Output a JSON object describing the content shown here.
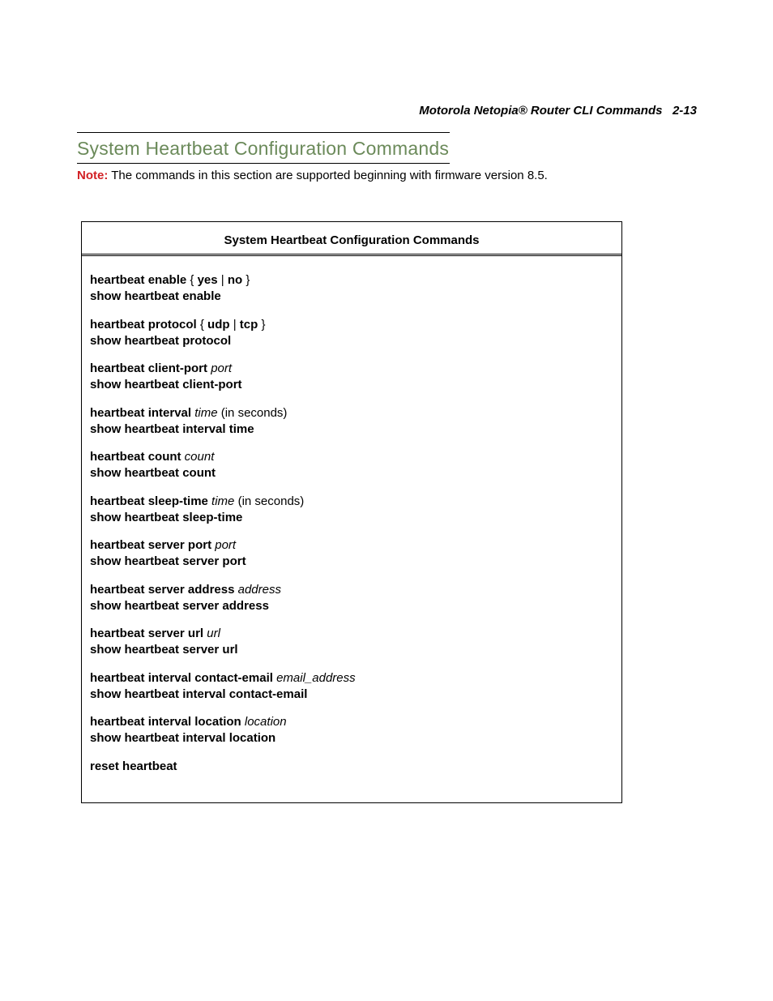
{
  "header": {
    "doc_title": "Motorola Netopia® Router CLI Commands",
    "page_ref": "2-13"
  },
  "section": {
    "title": "System Heartbeat Configuration Commands"
  },
  "note": {
    "label": "Note:",
    "text": "The commands in this section are supported beginning with firmware version 8.5."
  },
  "box": {
    "title": "System Heartbeat Configuration Commands",
    "groups": [
      {
        "line1_bold_a": "heartbeat enable",
        "line1_plain_a": " { ",
        "line1_bold_b": "yes",
        "line1_plain_b": " | ",
        "line1_bold_c": "no",
        "line1_plain_c": " }",
        "line2_bold": "show heartbeat enable"
      },
      {
        "line1_bold_a": "heartbeat protocol",
        "line1_plain_a": " { ",
        "line1_bold_b": "udp",
        "line1_plain_b": " | ",
        "line1_bold_c": "tcp",
        "line1_plain_c": " }",
        "line2_bold": "show heartbeat protocol"
      },
      {
        "line1_bold_a": "heartbeat client-port",
        "line1_ital": " port",
        "line2_bold": "show heartbeat client-port"
      },
      {
        "line1_bold_a": "heartbeat interval",
        "line1_ital": " time",
        "line1_plain_a": " (in seconds)",
        "line2_bold": "show heartbeat interval time"
      },
      {
        "line1_bold_a": "heartbeat count",
        "line1_ital": " count",
        "line2_bold": "show heartbeat count"
      },
      {
        "line1_bold_a": "heartbeat sleep-time",
        "line1_ital": " time",
        "line1_plain_a": " (in seconds)",
        "line2_bold": "show heartbeat sleep-time"
      },
      {
        "line1_bold_a": "heartbeat server port",
        "line1_ital": " port",
        "line2_bold": "show heartbeat server port"
      },
      {
        "line1_bold_a": "heartbeat server address",
        "line1_ital": " address",
        "line2_bold": "show heartbeat server address"
      },
      {
        "line1_bold_a": "heartbeat server url",
        "line1_ital": " url",
        "line2_bold": "show heartbeat server url"
      },
      {
        "line1_bold_a": "heartbeat interval contact-email",
        "line1_ital": " email_address",
        "line2_bold": "show heartbeat interval contact-email"
      },
      {
        "line1_bold_a": "heartbeat interval location",
        "line1_ital": " location",
        "line2_bold": "show heartbeat interval location"
      },
      {
        "line1_bold_a": "reset heartbeat"
      }
    ]
  }
}
